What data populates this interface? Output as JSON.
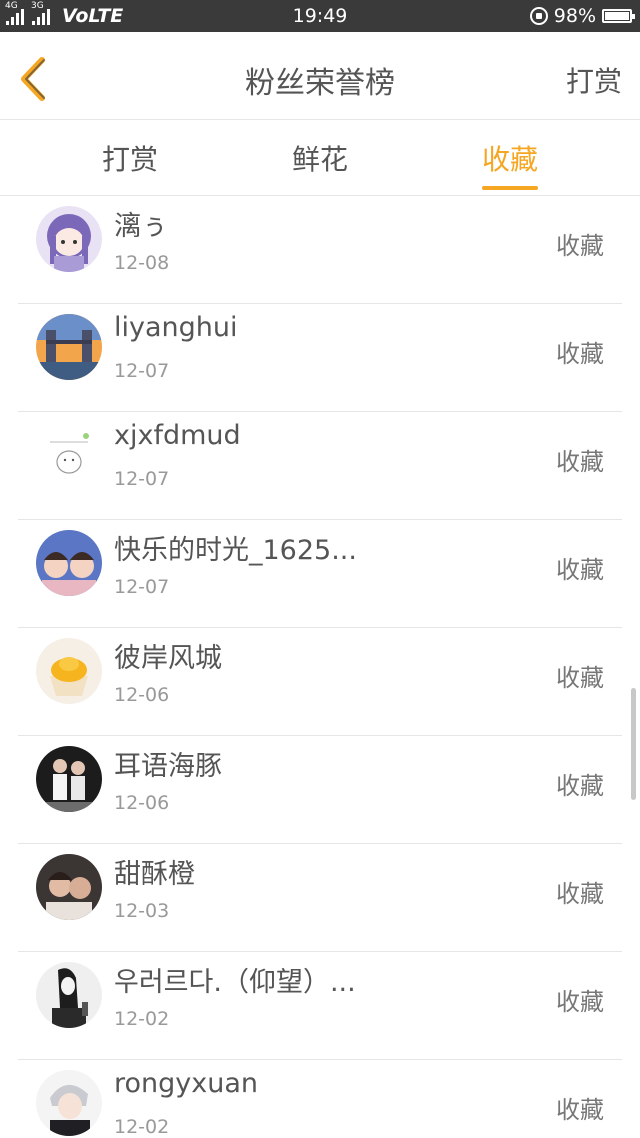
{
  "status_bar": {
    "net1": "4G",
    "net2": "3G",
    "volte": "VoLTE",
    "time": "19:49",
    "battery": "98%"
  },
  "nav": {
    "title": "粉丝荣誉榜",
    "right_label": "打赏"
  },
  "tabs": [
    {
      "label": "打赏",
      "active": false
    },
    {
      "label": "鲜花",
      "active": false
    },
    {
      "label": "收藏",
      "active": true
    }
  ],
  "list": [
    {
      "name": "漓ぅ",
      "date": "12-08",
      "action": "收藏",
      "avatar_icon": "anime-girl-avatar-icon"
    },
    {
      "name": "liyanghui",
      "date": "12-07",
      "action": "收藏",
      "avatar_icon": "tower-bridge-avatar-icon"
    },
    {
      "name": "xjxfdmud",
      "date": "12-07",
      "action": "收藏",
      "avatar_icon": "doodle-avatar-icon"
    },
    {
      "name": "快乐的时光_1625...",
      "date": "12-07",
      "action": "收藏",
      "avatar_icon": "kids-photo-avatar-icon"
    },
    {
      "name": "彼岸风城",
      "date": "12-06",
      "action": "收藏",
      "avatar_icon": "cupcake-avatar-icon"
    },
    {
      "name": "耳语海豚",
      "date": "12-06",
      "action": "收藏",
      "avatar_icon": "couple-photo-avatar-icon"
    },
    {
      "name": "甜酥橙",
      "date": "12-03",
      "action": "收藏",
      "avatar_icon": "couple-selfie-avatar-icon"
    },
    {
      "name": "우러르다.（仰望）...",
      "date": "12-02",
      "action": "收藏",
      "avatar_icon": "bw-girl-avatar-icon"
    },
    {
      "name": "rongyxuan",
      "date": "12-02",
      "action": "收藏",
      "avatar_icon": "anime-character-avatar-icon"
    }
  ],
  "colors": {
    "accent": "#f5a623",
    "status_bar_bg": "#3a3a3a",
    "text": "#555555",
    "subtext": "#999999",
    "divider": "#e6e6e6"
  }
}
